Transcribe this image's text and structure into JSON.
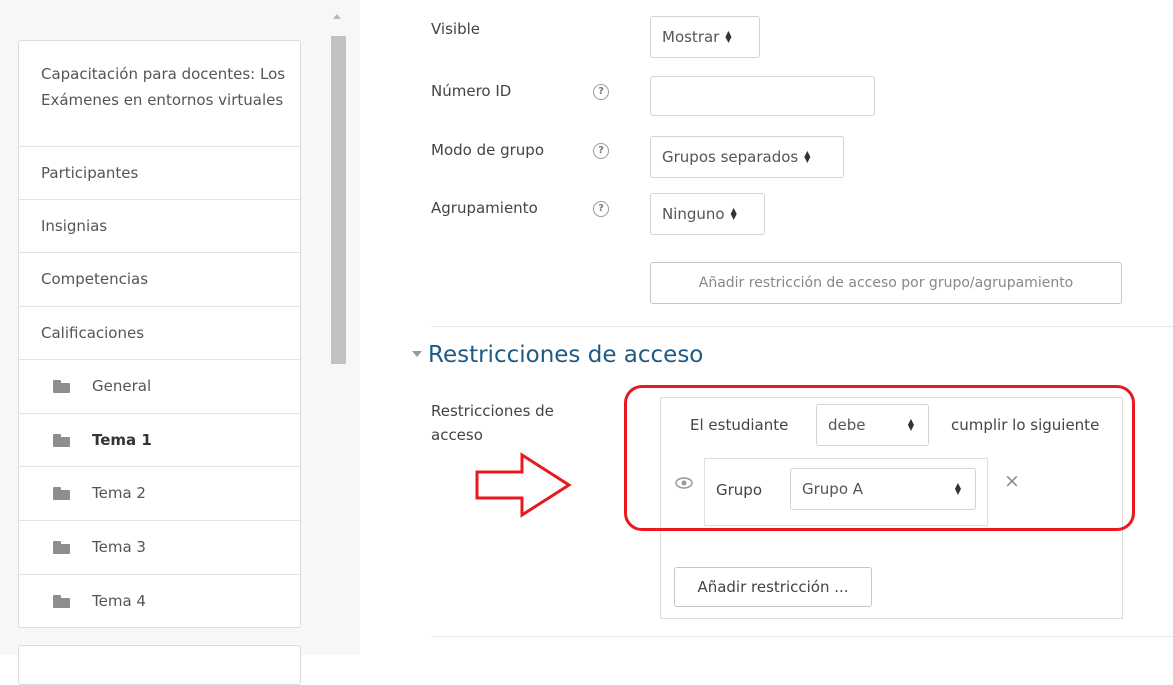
{
  "sidebar": {
    "course_title": "Capacitación para docentes: Los Exámenes en entornos virtuales",
    "items": [
      {
        "label": "Participantes"
      },
      {
        "label": "Insignias"
      },
      {
        "label": "Competencias"
      },
      {
        "label": "Calificaciones"
      }
    ],
    "sections": [
      {
        "label": "General",
        "icon": "folder-icon"
      },
      {
        "label": "Tema 1",
        "icon": "folder-icon",
        "current": true
      },
      {
        "label": "Tema 2",
        "icon": "folder-icon"
      },
      {
        "label": "Tema 3",
        "icon": "folder-icon"
      },
      {
        "label": "Tema 4",
        "icon": "folder-icon"
      }
    ]
  },
  "form": {
    "visible": {
      "label": "Visible",
      "value": "Mostrar"
    },
    "id_number": {
      "label": "Número ID",
      "value": ""
    },
    "group_mode": {
      "label": "Modo de grupo",
      "value": "Grupos separados"
    },
    "grouping": {
      "label": "Agrupamiento",
      "value": "Ninguno"
    },
    "add_group_restriction_button": "Añadir restricción de acceso por grupo/agrupamiento",
    "help_icon": "?"
  },
  "restrictions": {
    "section_title": "Restricciones de acceso",
    "label": "Restricciones de acceso",
    "student_text": "El estudiante",
    "must_value": "debe",
    "condition_text": "cumplir lo siguiente",
    "condition": {
      "type_label": "Grupo",
      "group_value": "Grupo A",
      "eye_icon": "eye-icon",
      "delete_icon": "×"
    },
    "add_restriction_button": "Añadir restricción ..."
  },
  "colors": {
    "section_title": "#1f5a85",
    "highlight_red": "#e8191f"
  }
}
